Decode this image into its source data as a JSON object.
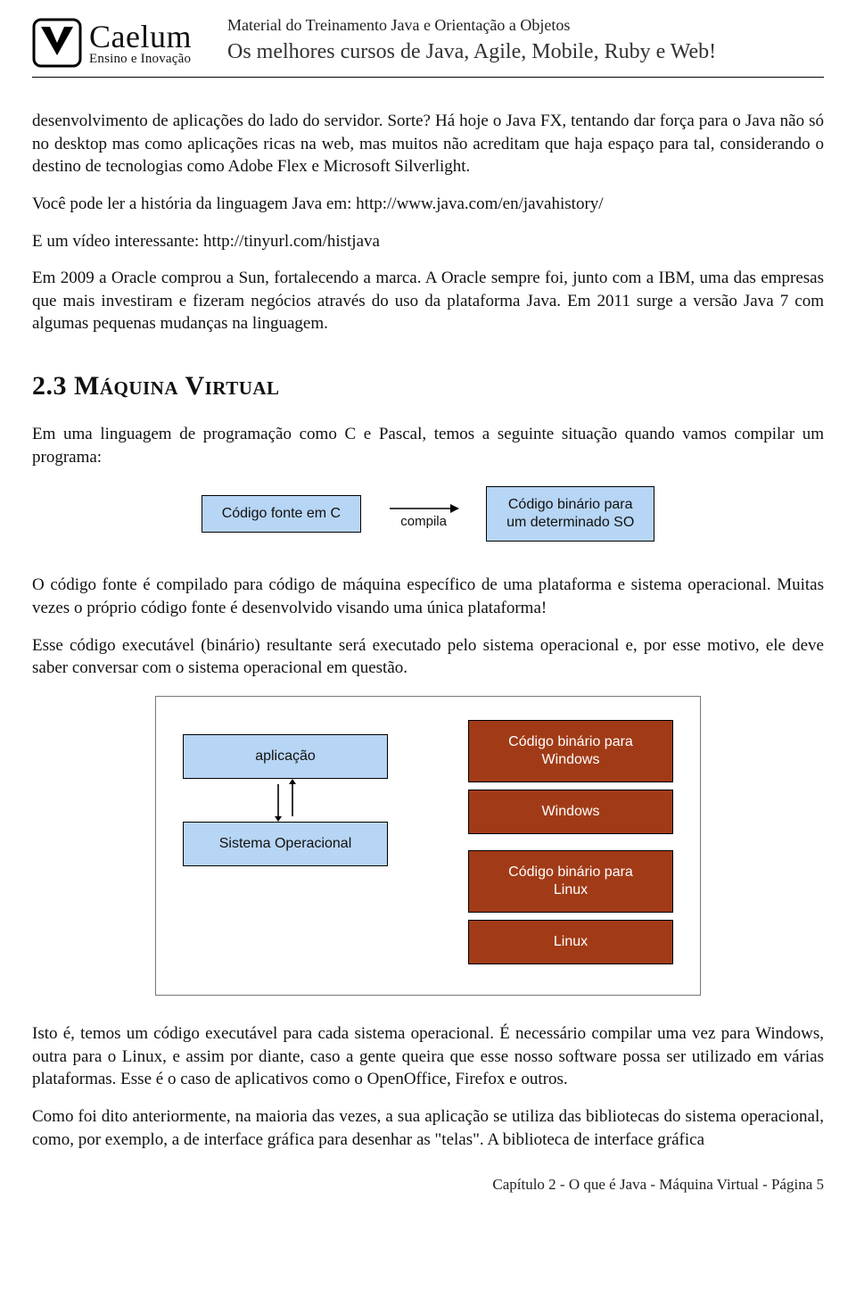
{
  "header": {
    "logo_brand": "Caelum",
    "logo_tag": "Ensino e Inovação",
    "training_note": "Material do Treinamento Java e Orientação a Objetos",
    "tagline": "Os melhores cursos de Java, Agile, Mobile, Ruby e Web!"
  },
  "paragraphs": {
    "p1": "desenvolvimento de aplicações do lado do servidor. Sorte? Há hoje o Java FX, tentando dar força para o Java não só no desktop mas como aplicações ricas na web, mas muitos não acreditam que haja espaço para tal, considerando o destino de tecnologias como Adobe Flex e Microsoft Silverlight.",
    "p2": "Você pode ler a história da linguagem Java em: http://www.java.com/en/javahistory/",
    "p3": "E um vídeo interessante: http://tinyurl.com/histjava",
    "p4": "Em 2009 a Oracle comprou a Sun, fortalecendo a marca. A Oracle sempre foi, junto com a IBM, uma das empresas que mais investiram e fizeram negócios através do uso da plataforma Java. Em 2011 surge a versão Java 7 com algumas pequenas mudanças na linguagem.",
    "p5": "Em uma linguagem de programação como C e Pascal, temos a seguinte situação quando vamos compilar um programa:",
    "p6": "O código fonte é compilado para código de máquina específico de uma plataforma e sistema operacional. Muitas vezes o próprio código fonte é desenvolvido visando uma única plataforma!",
    "p7": "Esse código executável (binário) resultante será executado pelo sistema operacional e, por esse motivo, ele deve saber conversar com o sistema operacional em questão.",
    "p8": "Isto é, temos um código executável para cada sistema operacional. É necessário compilar uma vez para Windows, outra para o Linux, e assim por diante, caso a gente queira que esse nosso software possa ser utilizado em várias plataformas. Esse é o caso de aplicativos como o OpenOffice, Firefox e outros.",
    "p9": "Como foi dito anteriormente, na maioria das vezes, a sua aplicação se utiliza das bibliotecas do sistema operacional, como, por exemplo, a de interface gráfica para desenhar as \"telas\". A biblioteca de interface gráfica"
  },
  "section": {
    "number_title": "2.3   Máquina Virtual"
  },
  "diagram1": {
    "left": "Código fonte em C",
    "arrow_label": "compila",
    "right": "Código binário para\num determinado SO"
  },
  "diagram2": {
    "left_top": "aplicação",
    "left_bottom": "Sistema Operacional",
    "right_1": "Código binário para\nWindows",
    "right_2": "Windows",
    "right_3": "Código binário para\nLinux",
    "right_4": "Linux"
  },
  "footer": "Capítulo 2 - O que é Java -   Máquina Virtual - Página 5"
}
